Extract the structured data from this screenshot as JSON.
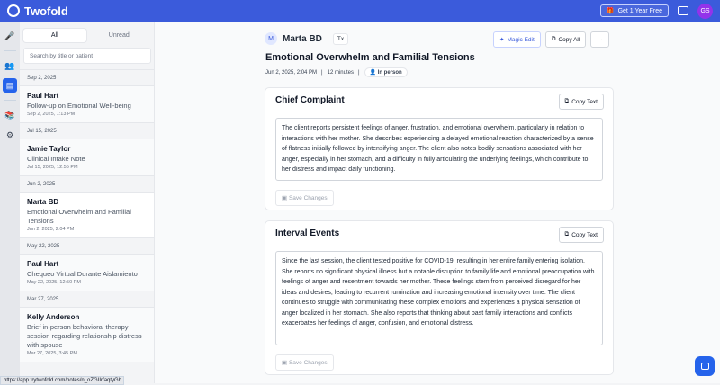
{
  "app": {
    "name": "Twofold"
  },
  "topbar": {
    "promo_label": "Get 1 Year Free",
    "avatar_initials": "GS"
  },
  "list": {
    "tabs": [
      "All",
      "Unread"
    ],
    "search_placeholder": "Search by title or patient",
    "groups": [
      {
        "date": "Sep 2, 2025",
        "items": [
          {
            "name": "Paul Hart",
            "title": "Follow-up on Emotional Well-being",
            "datetime": "Sep 2, 2025, 1:13 PM"
          }
        ]
      },
      {
        "date": "Jul 15, 2025",
        "items": [
          {
            "name": "Jamie Taylor",
            "title": "Clinical Intake Note",
            "datetime": "Jul 15, 2025, 12:55 PM"
          }
        ]
      },
      {
        "date": "Jun 2, 2025",
        "items": [
          {
            "name": "Marta BD",
            "title": "Emotional Overwhelm and Familial Tensions",
            "datetime": "Jun 2, 2025, 2:04 PM"
          }
        ]
      },
      {
        "date": "May 22, 2025",
        "items": [
          {
            "name": "Paul Hart",
            "title": "Chequeo Virtual Durante Aislamiento",
            "datetime": "May 22, 2025, 12:50 PM"
          }
        ]
      },
      {
        "date": "Mar 27, 2025",
        "items": [
          {
            "name": "Kelly Anderson",
            "title": "Brief in-person behavioral therapy session regarding relationship distress with spouse",
            "datetime": "Mar 27, 2025, 3:45 PM"
          }
        ]
      }
    ]
  },
  "status_url": "https://app.trytwofold.com/notes/n_oZGIIrfaqtyGb",
  "note": {
    "patient_initial": "M",
    "patient_name": "Marta BD",
    "tx_label": "Tx",
    "actions": {
      "magic": "Magic Edit",
      "copy_all": "Copy All",
      "more": "···"
    },
    "title": "Emotional Overwhelm and Familial Tensions",
    "date": "Jun 2, 2025, 2:04 PM",
    "duration": "12 minutes",
    "mode": "In person",
    "sections": [
      {
        "heading": "Chief Complaint",
        "copy_label": "Copy Text",
        "save_label": "Save Changes",
        "text": "The client reports persistent feelings of anger, frustration, and emotional overwhelm, particularly in relation to interactions with her mother. She describes experiencing a delayed emotional reaction characterized by a sense of flatness initially followed by intensifying anger. The client also notes bodily sensations associated with her anger, especially in her stomach, and a difficulty in fully articulating the underlying feelings, which contribute to her distress and impact daily functioning."
      },
      {
        "heading": "Interval Events",
        "copy_label": "Copy Text",
        "save_label": "Save Changes",
        "text": "Since the last session, the client tested positive for COVID-19, resulting in her entire family entering isolation. She reports no significant physical illness but a notable disruption to family life and emotional preoccupation with feelings of anger and resentment towards her mother. These feelings stem from perceived disregard for her ideas and desires, leading to recurrent rumination and increasing emotional intensity over time. The client continues to struggle with communicating these complex emotions and experiences a physical sensation of anger localized in her stomach. She also reports that thinking about past family interactions and conflicts exacerbates her feelings of anger, confusion, and emotional distress."
      }
    ]
  }
}
